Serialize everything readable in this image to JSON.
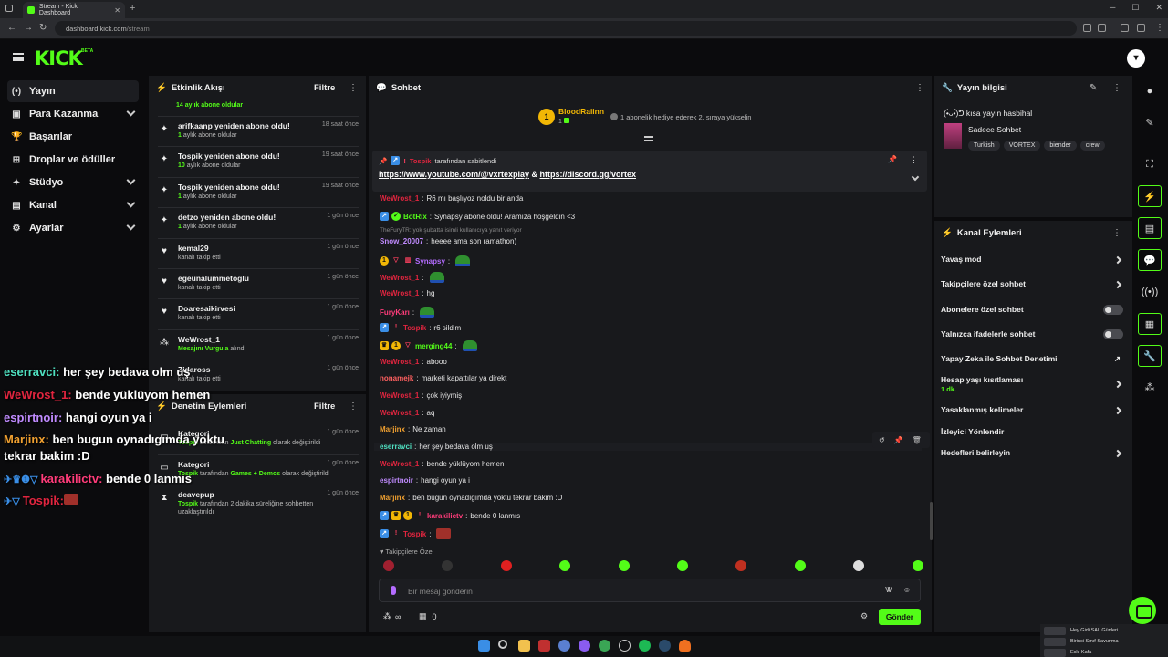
{
  "browser": {
    "tab_title": "Stream - Kick Dashboard",
    "url_domain": "dashboard.kick.com",
    "url_path": "/stream"
  },
  "brand": {
    "logo": "KICK",
    "badge": "BETA",
    "accent": "#53fc18"
  },
  "nav": [
    {
      "label": "Yayın",
      "icon": "broadcast-icon",
      "glyph": "(•)",
      "active": true,
      "expandable": false
    },
    {
      "label": "Para Kazanma",
      "icon": "money-icon",
      "glyph": "▣",
      "expandable": true
    },
    {
      "label": "Başarılar",
      "icon": "trophy-icon",
      "glyph": "🏆",
      "expandable": false
    },
    {
      "label": "Droplar ve ödüller",
      "icon": "gift-icon",
      "glyph": "⊞",
      "expandable": false
    },
    {
      "label": "Stüdyo",
      "icon": "studio-icon",
      "glyph": "✦",
      "expandable": true
    },
    {
      "label": "Kanal",
      "icon": "channel-icon",
      "glyph": "▤",
      "expandable": true
    },
    {
      "label": "Ayarlar",
      "icon": "gear-icon",
      "glyph": "⚙",
      "expandable": true
    }
  ],
  "activity": {
    "title": "Etkinlik Akışı",
    "filter": "Filtre",
    "top_partial": "14 aylık abone oldular",
    "items": [
      {
        "title": "arifkaanp yeniden abone oldu!",
        "sub_num": "1",
        "sub_text": " aylık abone oldular",
        "time": "18 saat önce",
        "icon": "star-icon",
        "glyph": "✦"
      },
      {
        "title": "Tospik yeniden abone oldu!",
        "sub_num": "10",
        "sub_text": " aylık abone oldular",
        "time": "19 saat önce",
        "icon": "star-icon",
        "glyph": "✦"
      },
      {
        "title": "Tospik yeniden abone oldu!",
        "sub_num": "1",
        "sub_text": " aylık abone oldular",
        "time": "19 saat önce",
        "icon": "star-icon",
        "glyph": "✦"
      },
      {
        "title": "detzo yeniden abone oldu!",
        "sub_num": "1",
        "sub_text": " aylık abone oldular",
        "time": "1 gün önce",
        "icon": "star-icon",
        "glyph": "✦"
      },
      {
        "title": "kemal29",
        "sub_num": "",
        "sub_text": "kanalı takip etti",
        "time": "1 gün önce",
        "icon": "heart-icon",
        "glyph": "♥"
      },
      {
        "title": "egeunalummetoglu",
        "sub_num": "",
        "sub_text": "kanalı takip etti",
        "time": "1 gün önce",
        "icon": "heart-icon",
        "glyph": "♥"
      },
      {
        "title": "Doaresaikirvesi",
        "sub_num": "",
        "sub_text": "kanalı takip etti",
        "time": "1 gün önce",
        "icon": "heart-icon",
        "glyph": "♥"
      },
      {
        "title": "WeWrost_1",
        "sub_num": "Mesajını Vurgula",
        "sub_text": " alındı",
        "time": "1 gün önce",
        "icon": "points-icon",
        "glyph": "⁂"
      },
      {
        "title": "Zidaross",
        "sub_num": "",
        "sub_text": "kanalı takip etti",
        "time": "1 gün önce",
        "icon": "heart-icon",
        "glyph": "♥"
      }
    ]
  },
  "moderation": {
    "title": "Denetim Eylemleri",
    "filter": "Filtre",
    "items": [
      {
        "title": "Kategori",
        "user": "Tospik",
        "pre": " tarafından ",
        "highlight": "Just Chatting",
        "post": " olarak değiştirildi",
        "time": "1 gün önce",
        "glyph": "▭"
      },
      {
        "title": "Kategori",
        "user": "Tospik",
        "pre": " tarafından ",
        "highlight": "Games + Demos",
        "post": " olarak değiştirildi",
        "time": "1 gün önce",
        "glyph": "▭"
      },
      {
        "title": "deavepup",
        "user": "Tospik",
        "pre": " tarafından 2 dakika süreliğine sohbetten",
        "highlight": "",
        "post": "",
        "line2": "uzaklaştırıldı",
        "time": "1 gün önce",
        "glyph": "⧗"
      }
    ]
  },
  "chat": {
    "title": "Sohbet",
    "gift_user": "BloodRaiinn",
    "gift_count": "1",
    "gift_msg": "1 abonelik hediye ederek 2. sıraya yükselin",
    "pinned_by_user": "Tospik",
    "pinned_by_text": "tarafından sabitlendi",
    "pinned_link1": "https://www.youtube.com/@vxrtexplay",
    "pinned_amp": " & ",
    "pinned_link2": "https://discord.gg/vortex",
    "messages": [
      {
        "user": "WeWrost_1",
        "cls": "u-red",
        "text": "R6 mı başlıyoz noldu bir anda"
      },
      {
        "user": "BotRix",
        "cls": "u-green",
        "text": "Synapsy abone oldu! Aramıza hoşgeldin <3"
      },
      {
        "reply": "TheFuryTR: yok şubatta isimli kullanıcıya yanıt veriyor",
        "user": "Snow_20007",
        "cls": "u-lav",
        "text": "heeee ama son ramathon)"
      },
      {
        "user": "Synapsy",
        "cls": "u-purple",
        "text": ""
      },
      {
        "user": "WeWrost_1",
        "cls": "u-red",
        "text": ""
      },
      {
        "user": "WeWrost_1",
        "cls": "u-red",
        "text": "hg"
      },
      {
        "user": "FuryKarı",
        "cls": "u-pink",
        "text": ""
      },
      {
        "user": "Tospik",
        "cls": "u-red",
        "text": "r6 sildim"
      },
      {
        "user": "merging44",
        "cls": "u-green",
        "text": ""
      },
      {
        "user": "WeWrost_1",
        "cls": "u-red",
        "text": "abooo"
      },
      {
        "user": "nonamejk",
        "cls": "u-salmon",
        "text": "marketi kapattılar ya direkt"
      },
      {
        "user": "WeWrost_1",
        "cls": "u-red",
        "text": "çok iyiymiş"
      },
      {
        "user": "WeWrost_1",
        "cls": "u-red",
        "text": "aq"
      },
      {
        "user": "Marjinx",
        "cls": "u-orange",
        "text": "Ne zaman"
      },
      {
        "user": "eserravci",
        "cls": "u-teal",
        "text": "her şey bedava olm uş"
      },
      {
        "user": "WeWrost_1",
        "cls": "u-red",
        "text": "bende yüklüyom hemen"
      },
      {
        "user": "espirtnoir",
        "cls": "u-lav",
        "text": "hangi oyun ya i"
      },
      {
        "user": "Marjinx",
        "cls": "u-orange",
        "text": "ben bugun oynadıgımda yoktu tekrar bakim :D"
      },
      {
        "user": "karakilictv",
        "cls": "u-pink",
        "text": "bende 0 lanmıs"
      },
      {
        "user": "Tospik",
        "cls": "u-red",
        "text": ""
      }
    ],
    "followers_only": "Takipçilere Özel",
    "input_placeholder": "Bir mesaj gönderin",
    "points": "∞",
    "count": "0",
    "send_label": "Gönder"
  },
  "stream_info": {
    "title": "Yayın bilgisi",
    "stream_title": "(•̀ᴗ•́)ᕤ kısa yayın hasbihal",
    "category": "Sadece Sohbet",
    "tags": [
      "Turkish",
      "VORTEX",
      "biender",
      "crew"
    ]
  },
  "channel_actions": {
    "title": "Kanal Eylemleri",
    "rows": [
      {
        "label": "Yavaş mod",
        "kind": "arrow"
      },
      {
        "label": "Takipçilere özel sohbet",
        "kind": "arrow"
      },
      {
        "label": "Abonelere özel sohbet",
        "kind": "toggle"
      },
      {
        "label": "Yalnızca ifadelerle sohbet",
        "kind": "toggle"
      },
      {
        "label": "Yapay Zeka ile Sohbet Denetimi",
        "kind": "ext"
      },
      {
        "label": "Hesap yaşı kısıtlaması",
        "sub": "1 dk.",
        "kind": "arrow"
      },
      {
        "label": "Yasaklanmış kelimeler",
        "kind": "arrow"
      },
      {
        "label": "İzleyici Yönlendir",
        "kind": "none"
      },
      {
        "label": "Hedefleri belirleyin",
        "kind": "arrow"
      }
    ]
  },
  "overlay": [
    {
      "user": "eserravci",
      "color": "#4fe0c0",
      "text": " her şey bedava olm uş"
    },
    {
      "user": "WeWrost_1",
      "color": "#e0253f",
      "text": " bende yüklüyom hemen"
    },
    {
      "user": "espirtnoir",
      "color": "#c08bff",
      "text": " hangi oyun ya i"
    },
    {
      "user": "Marjinx",
      "color": "#f0a030",
      "text": " ben bugun oynadıgımda yoktu"
    },
    {
      "user": "",
      "color": "#fff",
      "text": "tekrar bakim :D"
    },
    {
      "user": "karakilictv",
      "color": "#ff3c7a",
      "text": " bende 0 lanmıs"
    },
    {
      "user": "Tospik",
      "color": "#e0253f",
      "text": ""
    }
  ],
  "notifications": [
    "Hey Gidi SAL Günleri",
    "Birinci Sınıf Savunma",
    "Eski Kafa"
  ]
}
